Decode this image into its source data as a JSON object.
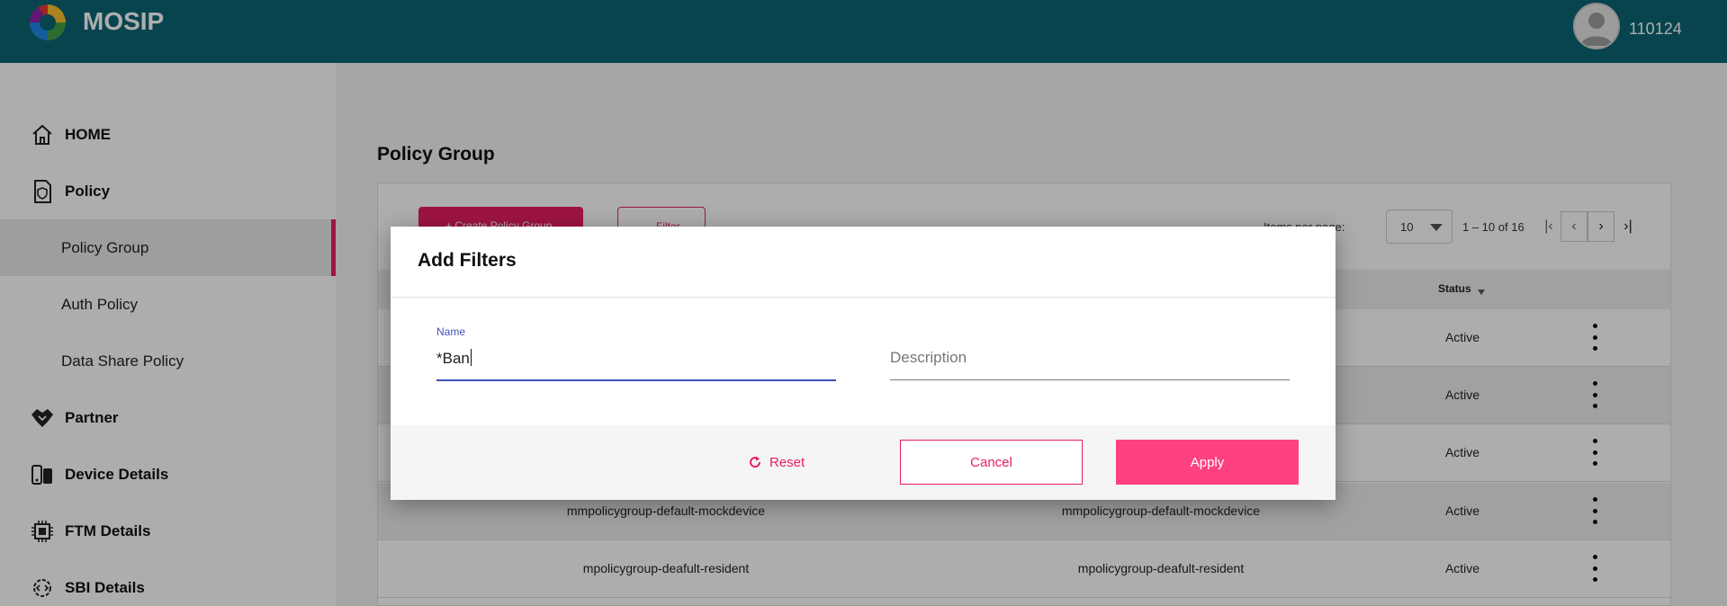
{
  "header": {
    "app_title": "MOSIP",
    "username": "110124",
    "brand_color": "#0b6574"
  },
  "sidebar": {
    "items": [
      {
        "label": "HOME",
        "icon": "home-icon"
      },
      {
        "label": "Policy",
        "icon": "policy-icon"
      },
      {
        "label": "Policy Group",
        "sub": true,
        "active": true
      },
      {
        "label": "Auth Policy",
        "sub": true
      },
      {
        "label": "Data Share Policy",
        "sub": true
      },
      {
        "label": "Partner",
        "icon": "handshake-icon"
      },
      {
        "label": "Device Details",
        "icon": "device-icon"
      },
      {
        "label": "FTM Details",
        "icon": "chip-icon"
      },
      {
        "label": "SBI Details",
        "icon": "settings-code-icon"
      }
    ],
    "active_color": "#e91e63"
  },
  "main": {
    "page_title": "Policy Group",
    "create_button": "+ Create Policy Group",
    "filter_button": "Filter",
    "items_per_page_label": "Items per page:",
    "items_per_page_value": "10",
    "range_label": "1 – 10 of 16",
    "table": {
      "status_header": "Status",
      "rows": [
        {
          "name": "",
          "description": "",
          "status": "Active"
        },
        {
          "name": "",
          "description": "",
          "status": "Active"
        },
        {
          "name": "",
          "description": "",
          "status": "Active"
        },
        {
          "name": "mmpolicygroup-default-mockdevice",
          "description": "mmpolicygroup-default-mockdevice",
          "status": "Active"
        },
        {
          "name": "mpolicygroup-deafult-resident",
          "description": "mpolicygroup-deafult-resident",
          "status": "Active"
        }
      ]
    }
  },
  "dialog": {
    "title": "Add Filters",
    "name_label": "Name",
    "name_value": "*Ban",
    "description_placeholder": "Description",
    "reset_label": "Reset",
    "cancel_label": "Cancel",
    "apply_label": "Apply",
    "accent_color": "#ff4081",
    "focus_color": "#3f51b5"
  }
}
